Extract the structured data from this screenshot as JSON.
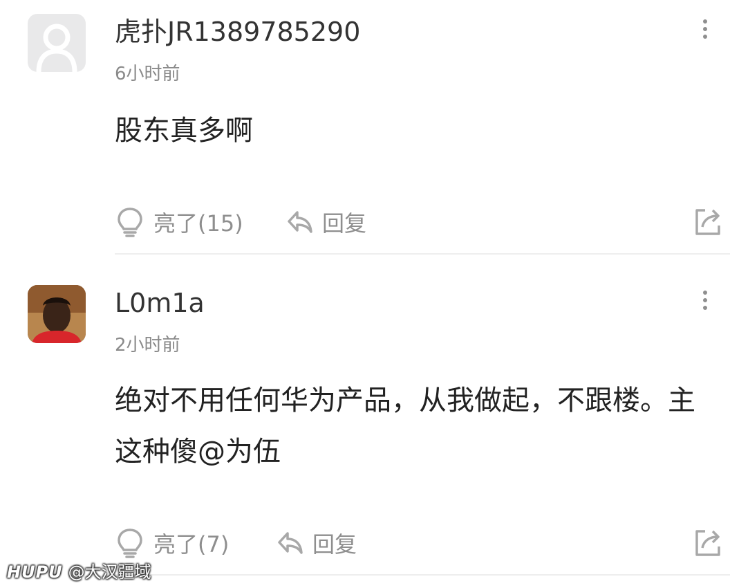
{
  "comments": [
    {
      "username": "虎扑JR1389785290",
      "time": "6小时前",
      "text": "股东真多啊",
      "avatar_icon": "default-user-icon",
      "like_label": "亮了(15)",
      "reply_label": "回复"
    },
    {
      "username": "L0m1a",
      "time": "2小时前",
      "text": "绝对不用任何华为产品，从我做起，不跟楼。主这种傻@为伍",
      "avatar_icon": "user-photo",
      "like_label": "亮了(7)",
      "reply_label": "回复"
    }
  ],
  "watermark": {
    "brand": "HUPU",
    "handle": "@大汉疆域"
  },
  "colors": {
    "text_primary": "#222222",
    "text_secondary": "#8a8a8a",
    "icon_gray": "#9a9a9a",
    "divider": "#eeeeee"
  }
}
